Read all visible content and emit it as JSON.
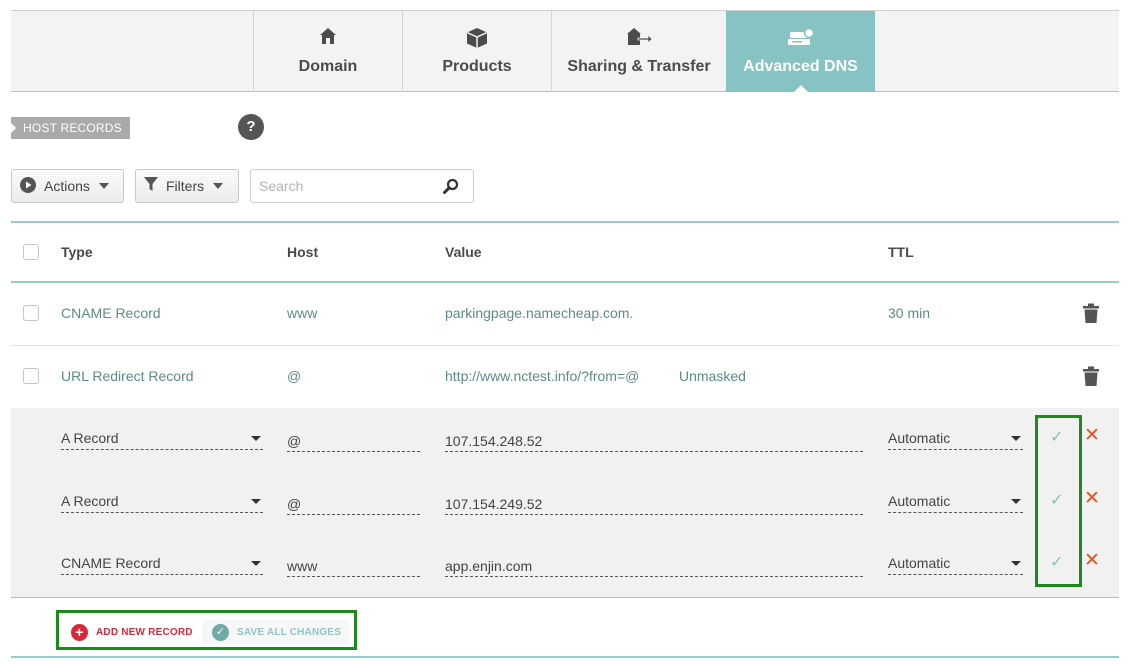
{
  "tabs": [
    {
      "label": "Domain",
      "icon": "home-icon",
      "active": false
    },
    {
      "label": "Products",
      "icon": "box-icon",
      "active": false
    },
    {
      "label": "Sharing & Transfer",
      "icon": "transfer-icon",
      "active": false
    },
    {
      "label": "Advanced DNS",
      "icon": "dns-server-icon",
      "active": true
    }
  ],
  "section": {
    "label": "HOST RECORDS",
    "help": "?"
  },
  "toolbar": {
    "actions_label": "Actions",
    "filters_label": "Filters",
    "search_placeholder": "Search"
  },
  "table": {
    "headers": {
      "type": "Type",
      "host": "Host",
      "value": "Value",
      "ttl": "TTL"
    },
    "rows": [
      {
        "type": "CNAME Record",
        "host": "www",
        "value": "parkingpage.namecheap.com.",
        "extra": "",
        "ttl": "30 min"
      },
      {
        "type": "URL Redirect Record",
        "host": "@",
        "value": "http://www.nctest.info/?from=@",
        "extra": "Unmasked",
        "ttl": ""
      }
    ],
    "edit_rows": [
      {
        "type": "A Record",
        "host": "@",
        "value": "107.154.248.52",
        "ttl": "Automatic"
      },
      {
        "type": "A Record",
        "host": "@",
        "value": "107.154.249.52",
        "ttl": "Automatic"
      },
      {
        "type": "CNAME Record",
        "host": "www",
        "value": "app.enjin.com",
        "ttl": "Automatic"
      }
    ]
  },
  "footer": {
    "add_label": "ADD NEW RECORD",
    "save_label": "SAVE ALL CHANGES"
  },
  "colors": {
    "accent": "#86c3c2",
    "highlight_box": "#1e8a1e",
    "cancel": "#e8521e",
    "add": "#d8293a"
  }
}
